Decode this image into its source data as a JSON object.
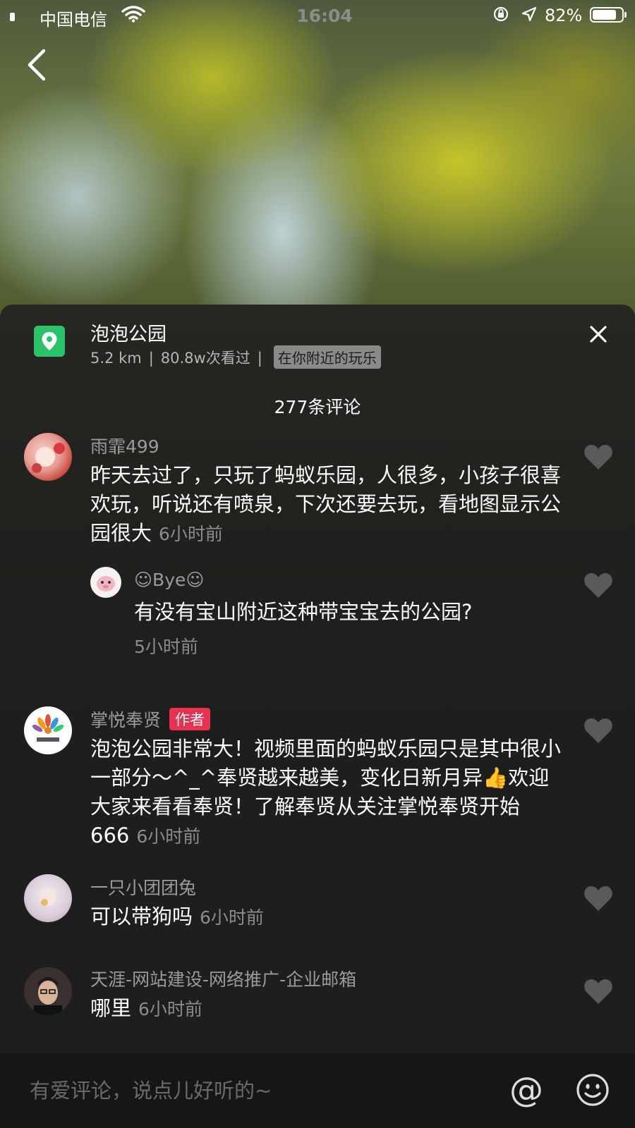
{
  "status_bar": {
    "carrier": "中国电信",
    "time": "16:04",
    "battery_pct": "82%",
    "battery_level": 0.82
  },
  "poi": {
    "name": "泡泡公园",
    "distance": "5.2 km",
    "views": "80.8w次看过",
    "separator": "|",
    "tag": "在你附近的玩乐"
  },
  "comments_header": {
    "count_label": "277条评论"
  },
  "comments": [
    {
      "username": "雨霏499",
      "text": "昨天去过了，只玩了蚂蚁乐园，人很多，小孩子很喜欢玩，听说还有喷泉，下次还要去玩，看地图显示公园很大",
      "time": "6小时前"
    },
    {
      "username": "☺Bye☺",
      "text": "有没有宝山附近这种带宝宝去的公园?",
      "time": "5小时前"
    },
    {
      "username": "掌悦奉贤",
      "badge": "作者",
      "text": "泡泡公园非常大！视频里面的蚂蚁乐园只是其中很小一部分～^_^奉贤越来越美，变化日新月异👍欢迎大家来看看奉贤！了解奉贤从关注掌悦奉贤开始666",
      "time": "6小时前"
    },
    {
      "username": "一只小团团兔",
      "text": "可以带狗吗",
      "time": "6小时前"
    },
    {
      "username": "天涯-网站建设-网络推广-企业邮箱",
      "text": "哪里",
      "time": "6小时前"
    }
  ],
  "input": {
    "placeholder": "有爱评论，说点儿好听的~",
    "at_symbol": "@"
  },
  "icons": {
    "back": "chevron-left-icon",
    "location": "location-pin-icon",
    "close": "close-icon",
    "like": "heart-icon",
    "emoji": "smiley-icon"
  },
  "colors": {
    "poi_icon": "#29c46a",
    "author_badge": "#e8314f",
    "tag_bg": "#8a8a8a"
  }
}
